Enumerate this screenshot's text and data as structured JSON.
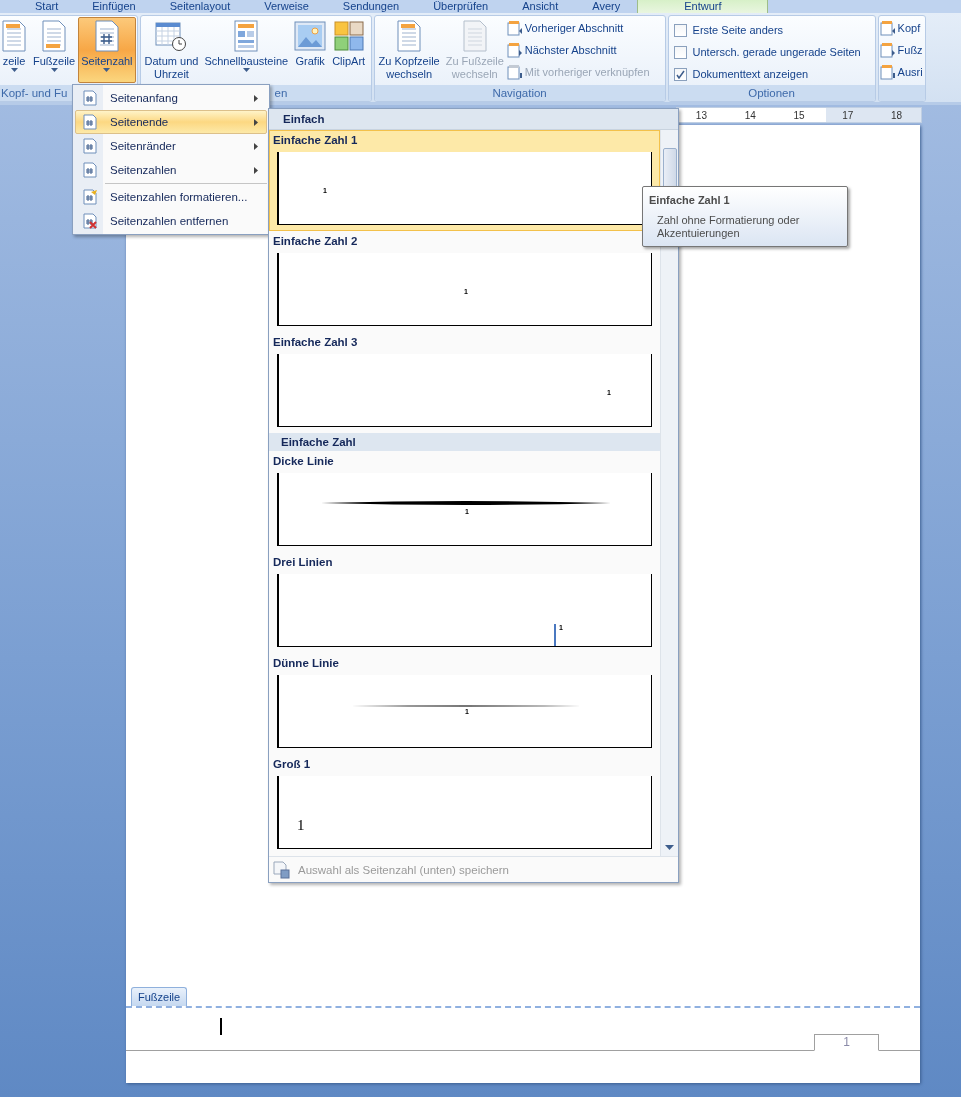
{
  "tabs": [
    {
      "label": "Start",
      "selected": false
    },
    {
      "label": "Einfügen",
      "selected": false
    },
    {
      "label": "Seitenlayout",
      "selected": false
    },
    {
      "label": "Verweise",
      "selected": false
    },
    {
      "label": "Sendungen",
      "selected": false
    },
    {
      "label": "Überprüfen",
      "selected": false
    },
    {
      "label": "Ansicht",
      "selected": false
    },
    {
      "label": "Avery",
      "selected": false
    },
    {
      "label": "Entwurf",
      "selected": true
    }
  ],
  "ribbon": {
    "groups": [
      {
        "label": "Kopf- und Fu",
        "large_buttons": [
          {
            "label": "zeile",
            "dropdown": true,
            "selected": false,
            "disabled": false
          },
          {
            "label": "Fußzeile",
            "dropdown": true,
            "selected": false,
            "disabled": false
          },
          {
            "label": "Seitenzahl",
            "dropdown": true,
            "selected": true,
            "disabled": false
          }
        ]
      },
      {
        "label": "en",
        "large_buttons": [
          {
            "label": "Datum und\nUhrzeit",
            "dropdown": false,
            "selected": false,
            "disabled": false
          },
          {
            "label": "Schnellbausteine",
            "dropdown": true,
            "selected": false,
            "disabled": false
          },
          {
            "label": "Grafik",
            "dropdown": false,
            "selected": false,
            "disabled": false
          },
          {
            "label": "ClipArt",
            "dropdown": false,
            "selected": false,
            "disabled": false
          }
        ]
      },
      {
        "label": "Navigation",
        "large_buttons": [
          {
            "label": "Zu Kopfzeile\nwechseln",
            "dropdown": false,
            "selected": false,
            "disabled": false
          },
          {
            "label": "Zu Fußzeile\nwechseln",
            "dropdown": false,
            "selected": false,
            "disabled": true
          }
        ],
        "small_buttons": [
          {
            "label": "Vorheriger Abschnitt",
            "disabled": false
          },
          {
            "label": "Nächster Abschnitt",
            "disabled": false
          },
          {
            "label": "Mit vorheriger verknüpfen",
            "disabled": true
          }
        ]
      },
      {
        "label": "Optionen",
        "checkboxes": [
          {
            "label": "Erste Seite anders",
            "checked": false
          },
          {
            "label": "Untersch. gerade  ungerade Seiten",
            "checked": false
          },
          {
            "label": "Dokumenttext anzeigen",
            "checked": true
          }
        ]
      },
      {
        "small_buttons": [
          {
            "label": "Kopf",
            "disabled": false
          },
          {
            "label": "Fußz",
            "disabled": false
          },
          {
            "label": "Ausri",
            "disabled": false
          }
        ]
      }
    ]
  },
  "ruler": {
    "numbers": [
      "13",
      "14",
      "15",
      "17",
      "18"
    ]
  },
  "page": {
    "footer_tab": "Fußzeile",
    "page_number": "1"
  },
  "menu": {
    "items": [
      {
        "label": "Seitenanfang",
        "submenu": true,
        "selected": false
      },
      {
        "label": "Seitenende",
        "submenu": true,
        "selected": true
      },
      {
        "label": "Seitenränder",
        "submenu": true,
        "selected": false
      },
      {
        "label": "Seitenzahlen",
        "submenu": true,
        "selected": false
      },
      {
        "label": "Seitenzahlen formatieren...",
        "submenu": false,
        "selected": false
      },
      {
        "label": "Seitenzahlen entfernen",
        "submenu": false,
        "selected": false
      }
    ]
  },
  "gallery": {
    "header": "Einfach",
    "entries": [
      {
        "kind": "item",
        "label": "Einfache Zahl 1",
        "number": "1",
        "selected": true
      },
      {
        "kind": "item",
        "label": "Einfache Zahl 2",
        "number": "1",
        "selected": false
      },
      {
        "kind": "item",
        "label": "Einfache Zahl 3",
        "number": "1",
        "selected": false
      },
      {
        "kind": "section",
        "label": "Einfache Zahl"
      },
      {
        "kind": "item",
        "label": "Dicke Linie",
        "number": "1",
        "selected": false
      },
      {
        "kind": "item",
        "label": "Drei Linien",
        "number": "1",
        "selected": false
      },
      {
        "kind": "item",
        "label": "Dünne Linie",
        "number": "1",
        "selected": false
      },
      {
        "kind": "item",
        "label": "Groß 1",
        "number": "1",
        "selected": false
      }
    ],
    "footer": {
      "label": "Auswahl als Seitenzahl (unten) speichern",
      "disabled": true
    }
  },
  "tooltip": {
    "title": "Einfache Zahl 1",
    "text": "Zahl ohne Formatierung oder Akzentuierungen"
  }
}
